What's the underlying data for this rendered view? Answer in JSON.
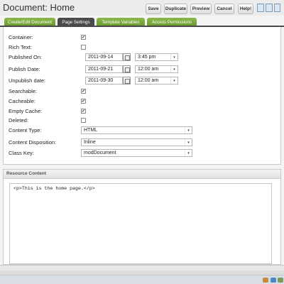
{
  "header": {
    "title": "Document: Home",
    "buttons": {
      "save": "Save",
      "duplicate": "Duplicate",
      "preview": "Preview",
      "cancel": "Cancel",
      "help": "Help!"
    }
  },
  "tabs": [
    {
      "label": "Create/Edit Document",
      "active": false
    },
    {
      "label": "Page Settings",
      "active": true
    },
    {
      "label": "Template Variables",
      "active": false
    },
    {
      "label": "Access Permissions",
      "active": false
    }
  ],
  "settings": {
    "container": {
      "label": "Container:",
      "checked": true
    },
    "rich_text": {
      "label": "Rich Text:",
      "checked": false
    },
    "published_on": {
      "label": "Published On:",
      "date": "2011-09-14",
      "time": "3:45 pm"
    },
    "publish_date": {
      "label": "Publish Date:",
      "date": "2011-09-21",
      "time": "12:00 am"
    },
    "unpublish_date": {
      "label": "Unpublish date:",
      "date": "2011-09-30",
      "time": "12:00 am"
    },
    "searchable": {
      "label": "Searchable:",
      "checked": true
    },
    "cacheable": {
      "label": "Cacheable:",
      "checked": true
    },
    "empty_cache": {
      "label": "Empty Cache:",
      "checked": true
    },
    "deleted": {
      "label": "Deleted:",
      "checked": false
    },
    "content_type": {
      "label": "Content Type:",
      "value": "HTML"
    },
    "content_disposition": {
      "label": "Content Disposition:",
      "value": "Inline"
    },
    "class_key": {
      "label": "Class Key:",
      "value": "modDocument"
    }
  },
  "resource_content": {
    "title": "Resource Content",
    "content": "<p>This is the home page.</p>"
  },
  "icons": {
    "checkmark": "✔",
    "dropdown": "▾"
  }
}
